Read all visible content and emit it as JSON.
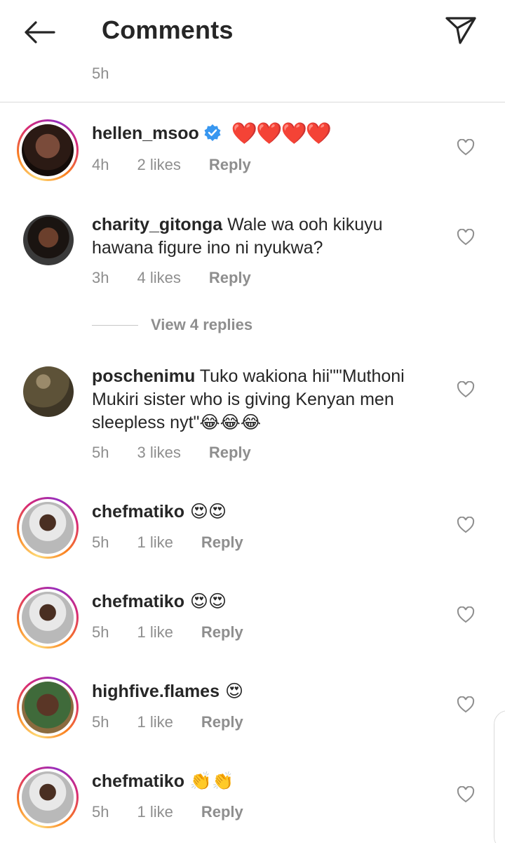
{
  "header": {
    "title": "Comments",
    "back_icon": "arrow-left-icon",
    "send_icon": "paper-plane-icon"
  },
  "top_time": "5h",
  "comments": [
    {
      "username": "hellen_msoo",
      "verified": true,
      "text": "❤️❤️❤️❤️",
      "time": "4h",
      "likes": "2 likes",
      "reply": "Reply",
      "avatar_story_ring": true
    },
    {
      "username": "charity_gitonga",
      "text": " Wale wa ooh kikuyu hawana figure ino ni nyukwa?",
      "time": "3h",
      "likes": "4 likes",
      "reply": "Reply",
      "avatar_story_ring": false
    },
    {
      "username": "poschenimu",
      "text": " Tuko wakiona hii\"\"Muthoni Mukiri sister who is giving Kenyan men sleepless nyt\"😂😂😂",
      "time": "5h",
      "likes": "3 likes",
      "reply": "Reply",
      "avatar_story_ring": false
    },
    {
      "username": "chefmatiko",
      "text": " 😍😍",
      "time": "5h",
      "likes": "1 like",
      "reply": "Reply",
      "avatar_story_ring": true
    },
    {
      "username": "chefmatiko",
      "text": " 😍😍",
      "time": "5h",
      "likes": "1 like",
      "reply": "Reply",
      "avatar_story_ring": true
    },
    {
      "username": "highfive.flames",
      "text": " 😍",
      "time": "5h",
      "likes": "1 like",
      "reply": "Reply",
      "avatar_story_ring": true
    },
    {
      "username": "chefmatiko",
      "text": " 👏👏",
      "time": "5h",
      "likes": "1 like",
      "reply": "Reply",
      "avatar_story_ring": true
    }
  ],
  "view_replies": "View 4 replies",
  "colors": {
    "text": "#262626",
    "secondary": "#8e8e8e",
    "verified": "#3897f0",
    "heart_red": "#e0142d"
  }
}
